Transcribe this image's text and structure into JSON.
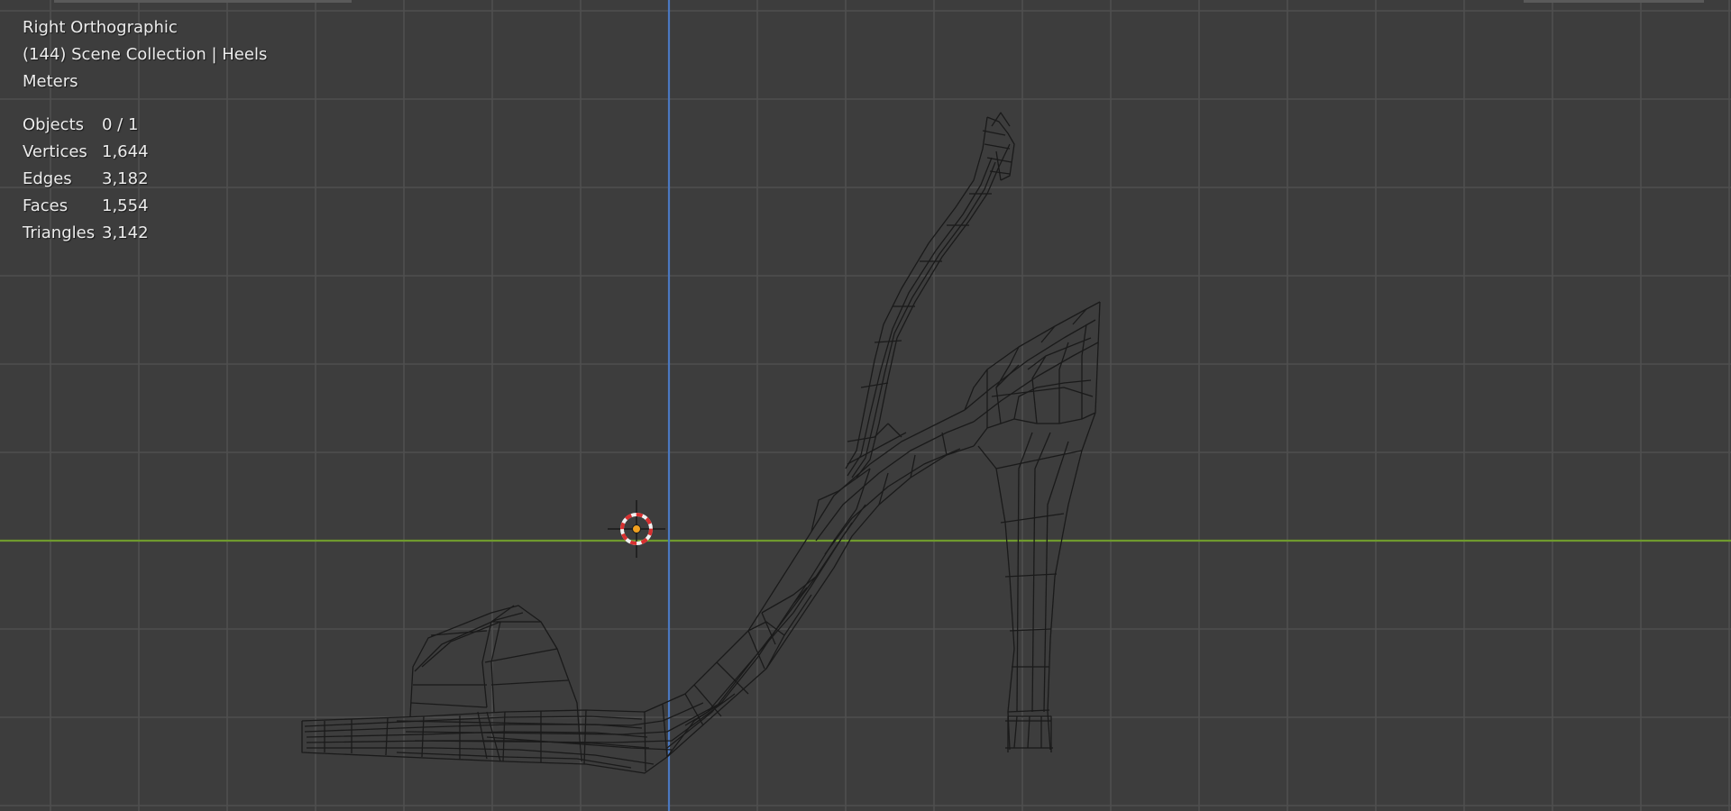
{
  "viewport": {
    "view_name": "Right Orthographic",
    "collection_info": "(144) Scene Collection | Heels",
    "units": "Meters",
    "colors": {
      "background": "#3d3d3d",
      "grid_line": "#4f4f4f",
      "horizontal_axis": "#6f9a2e",
      "vertical_axis": "#4a78c0",
      "wireframe": "#1a1a1a",
      "cursor_red": "#d83030",
      "cursor_white": "#f0f0f0",
      "origin_dot": "#f0a020"
    }
  },
  "stats": [
    {
      "label": "Objects",
      "value": "0 / 1"
    },
    {
      "label": "Vertices",
      "value": "1,644"
    },
    {
      "label": "Edges",
      "value": "3,182"
    },
    {
      "label": "Faces",
      "value": "1,554"
    },
    {
      "label": "Triangles",
      "value": "3,142"
    }
  ],
  "scene_objects": [
    {
      "name": "heel-shoe-wireframe",
      "icon": "mesh-icon"
    },
    {
      "name": "3d-cursor",
      "icon": "cursor-icon"
    }
  ]
}
